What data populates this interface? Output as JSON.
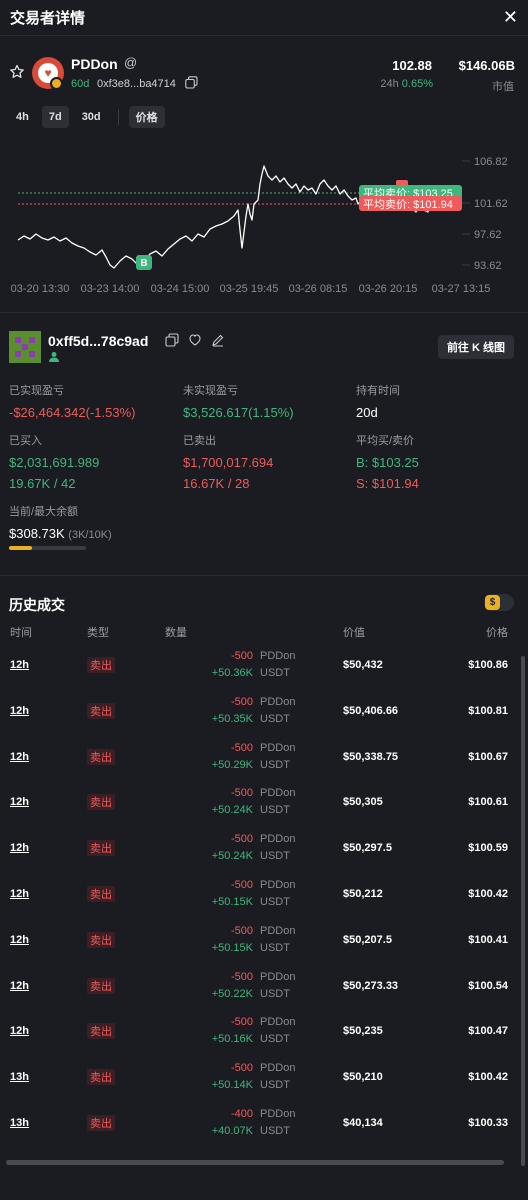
{
  "header": {
    "title": "交易者详情",
    "close_label": "✕"
  },
  "token": {
    "name": "PDDon",
    "age": "60d",
    "address": "0xf3e8...ba4714",
    "price": "102.88",
    "change_label": "24h",
    "change_value": "0.65%",
    "market_cap": "$146.06B",
    "market_cap_label": "市值"
  },
  "timeframes": [
    "4h",
    "7d",
    "30d"
  ],
  "active_timeframe": "7d",
  "price_toggle": "价格",
  "chart_data": {
    "type": "line",
    "y_ticks": [
      "106.82",
      "101.62",
      "97.62",
      "93.62"
    ],
    "x_ticks": [
      "03-20 13:30",
      "03-23 14:00",
      "03-24 15:00",
      "03-25 19:45",
      "03-26 08:15",
      "03-26 20:15",
      "03-27 13:15"
    ],
    "avg_sell_label": "平均卖价: $103.25",
    "avg_buy_label": "平均卖价: $101.94",
    "buy_marker": "B",
    "avg_sell_price": 103.25,
    "avg_buy_price": 101.94,
    "colors": {
      "line": "#ffffff",
      "up": "#3fb67c",
      "down": "#f05a5a"
    }
  },
  "trader": {
    "name": "0xff5d...78c9ad",
    "kline_button": "前往 K 线图"
  },
  "stats": {
    "realized_label": "已实现盈亏",
    "realized_value": "-$26,464.342(-1.53%)",
    "unrealized_label": "未实现盈亏",
    "unrealized_value": "$3,526.617(1.15%)",
    "hold_label": "持有时间",
    "hold_value": "20d",
    "bought_label": "已买入",
    "bought_value": "$2,031,691.989",
    "bought_sub": "19.67K / 42",
    "sold_label": "已卖出",
    "sold_value": "$1,700,017.694",
    "sold_sub": "16.67K / 28",
    "avg_label": "平均买/卖价",
    "avg_buy": "B: $103.25",
    "avg_sell": "S: $101.94",
    "balance_label": "当前/最大余额",
    "balance_value": "$308.73K",
    "balance_sub": "(3K/10K)",
    "balance_fraction": 0.3
  },
  "history": {
    "title": "历史成交",
    "toggle_icon": "$",
    "columns": {
      "time": "时间",
      "type": "类型",
      "qty": "数量",
      "value": "价值",
      "price": "价格"
    },
    "rows": [
      {
        "time": "12h",
        "type": "卖出",
        "q1": "-500",
        "q1t": "PDDon",
        "q2": "+50.36K",
        "q2t": "USDT",
        "value": "$50,432",
        "price": "$100.86"
      },
      {
        "time": "12h",
        "type": "卖出",
        "q1": "-500",
        "q1t": "PDDon",
        "q2": "+50.35K",
        "q2t": "USDT",
        "value": "$50,406.66",
        "price": "$100.81"
      },
      {
        "time": "12h",
        "type": "卖出",
        "q1": "-500",
        "q1t": "PDDon",
        "q2": "+50.29K",
        "q2t": "USDT",
        "value": "$50,338.75",
        "price": "$100.67"
      },
      {
        "time": "12h",
        "type": "卖出",
        "q1": "-500",
        "q1t": "PDDon",
        "q2": "+50.24K",
        "q2t": "USDT",
        "value": "$50,305",
        "price": "$100.61"
      },
      {
        "time": "12h",
        "type": "卖出",
        "q1": "-500",
        "q1t": "PDDon",
        "q2": "+50.24K",
        "q2t": "USDT",
        "value": "$50,297.5",
        "price": "$100.59"
      },
      {
        "time": "12h",
        "type": "卖出",
        "q1": "-500",
        "q1t": "PDDon",
        "q2": "+50.15K",
        "q2t": "USDT",
        "value": "$50,212",
        "price": "$100.42"
      },
      {
        "time": "12h",
        "type": "卖出",
        "q1": "-500",
        "q1t": "PDDon",
        "q2": "+50.15K",
        "q2t": "USDT",
        "value": "$50,207.5",
        "price": "$100.41"
      },
      {
        "time": "12h",
        "type": "卖出",
        "q1": "-500",
        "q1t": "PDDon",
        "q2": "+50.22K",
        "q2t": "USDT",
        "value": "$50,273.33",
        "price": "$100.54"
      },
      {
        "time": "12h",
        "type": "卖出",
        "q1": "-500",
        "q1t": "PDDon",
        "q2": "+50.16K",
        "q2t": "USDT",
        "value": "$50,235",
        "price": "$100.47"
      },
      {
        "time": "13h",
        "type": "卖出",
        "q1": "-500",
        "q1t": "PDDon",
        "q2": "+50.14K",
        "q2t": "USDT",
        "value": "$50,210",
        "price": "$100.42"
      },
      {
        "time": "13h",
        "type": "卖出",
        "q1": "-400",
        "q1t": "PDDon",
        "q2": "+40.07K",
        "q2t": "USDT",
        "value": "$40,134",
        "price": "$100.33"
      }
    ]
  }
}
